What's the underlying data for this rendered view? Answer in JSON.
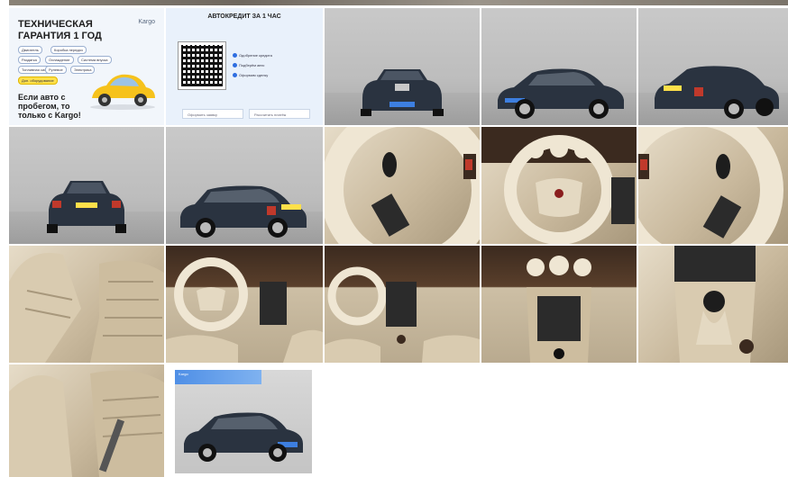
{
  "promo": {
    "title": "ТЕХНИЧЕСКАЯ ГАРАНТИЯ 1 ГОД",
    "logo": "Kargo",
    "chips": [
      "Двигатель",
      "Коробка передач",
      "Раздатка",
      "Охлаждение",
      "Система впуска",
      "Топливная система",
      "Рулевое",
      "Электрика",
      "Кузов",
      "Доп. оборудование"
    ],
    "footer": "Если авто с пробегом, то только с Kargo!"
  },
  "credit": {
    "title": "АВТОКРЕДИТ ЗА 1 ЧАС",
    "bullets": [
      "Одобрение кредита",
      "Подберём авто",
      "Оформим сделку"
    ],
    "buttons": [
      "Оформить заявку",
      "Рассчитать платёж"
    ]
  },
  "last_badge": "Kargo",
  "colors": {
    "accent": "#2f6ee0",
    "car_body": "#2a3340",
    "plate": "#ffe04a"
  }
}
